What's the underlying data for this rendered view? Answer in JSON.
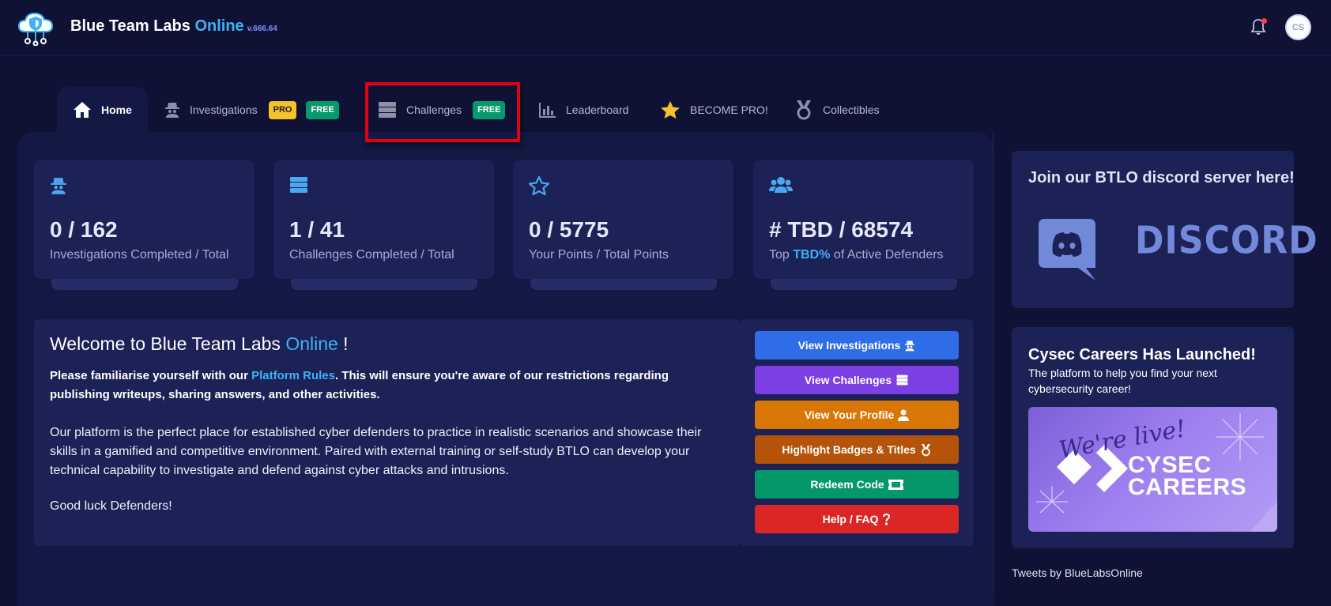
{
  "app": {
    "brand_main": "Blue Team Labs ",
    "brand_accent": "Online",
    "version": "v.666.64",
    "avatar_initials": "CS"
  },
  "tabs": [
    {
      "label": "Home"
    },
    {
      "label": "Investigations",
      "badges": [
        "PRO",
        "FREE"
      ]
    },
    {
      "label": "Challenges",
      "badges": [
        "FREE"
      ]
    },
    {
      "label": "Leaderboard"
    },
    {
      "label": "BECOME PRO!"
    },
    {
      "label": "Collectibles"
    }
  ],
  "stats": [
    {
      "value": "0 / 162",
      "label": "Investigations Completed / Total",
      "icon": "spy-icon"
    },
    {
      "value": "1 / 41",
      "label": "Challenges Completed / Total",
      "icon": "server-icon"
    },
    {
      "value": "0 / 5775",
      "label": "Your Points / Total Points",
      "icon": "star-icon"
    },
    {
      "value": "# TBD / 68574",
      "label_pre": "Top ",
      "label_accent": "TBD%",
      "label_post": " of Active Defenders",
      "icon": "users-icon"
    }
  ],
  "welcome": {
    "title_pre": "Welcome to Blue Team Labs ",
    "title_accent": "Online",
    "title_post": " !",
    "rules_pre": "Please familiarise yourself with our ",
    "rules_link": "Platform Rules",
    "rules_post": ". This will ensure you're aware of our restrictions regarding publishing writeups, sharing answers, and other activities.",
    "body": "Our platform is the perfect place for established cyber defenders to practice in realistic scenarios and showcase their skills in a gamified and competitive environment. Paired with external training or self-study BTLO can develop your technical capability to investigate and defend against cyber attacks and intrusions.",
    "closing": "Good luck Defenders!"
  },
  "actions": [
    {
      "label": "View Investigations",
      "color": "#2f6ce8",
      "icon": "spy-icon"
    },
    {
      "label": "View Challenges",
      "color": "#7b3fe4",
      "icon": "server-icon"
    },
    {
      "label": "View Your Profile",
      "color": "#d97706",
      "icon": "user-icon"
    },
    {
      "label": "Highlight Badges & Titles",
      "color": "#b45309",
      "icon": "medal-icon"
    },
    {
      "label": "Redeem Code",
      "color": "#059669",
      "icon": "ticket-icon"
    },
    {
      "label": "Help / FAQ",
      "color": "#dc2626",
      "icon": "question-icon"
    }
  ],
  "discord": {
    "title": "Join our BTLO discord server here!",
    "logo_text": "DISCORD"
  },
  "careers": {
    "title": "Cysec Careers Has Launched!",
    "desc": "The platform to help you find your next cybersecurity career!",
    "banner_script": "We're live!",
    "banner_line1": "CYSEC",
    "banner_line2": "CAREERS"
  },
  "tweets": "Tweets by BlueLabsOnline",
  "colors": {
    "accent": "#3fb2f5",
    "bg": "#0f1234",
    "card": "#1c2156",
    "highlight": "#e0000f"
  }
}
